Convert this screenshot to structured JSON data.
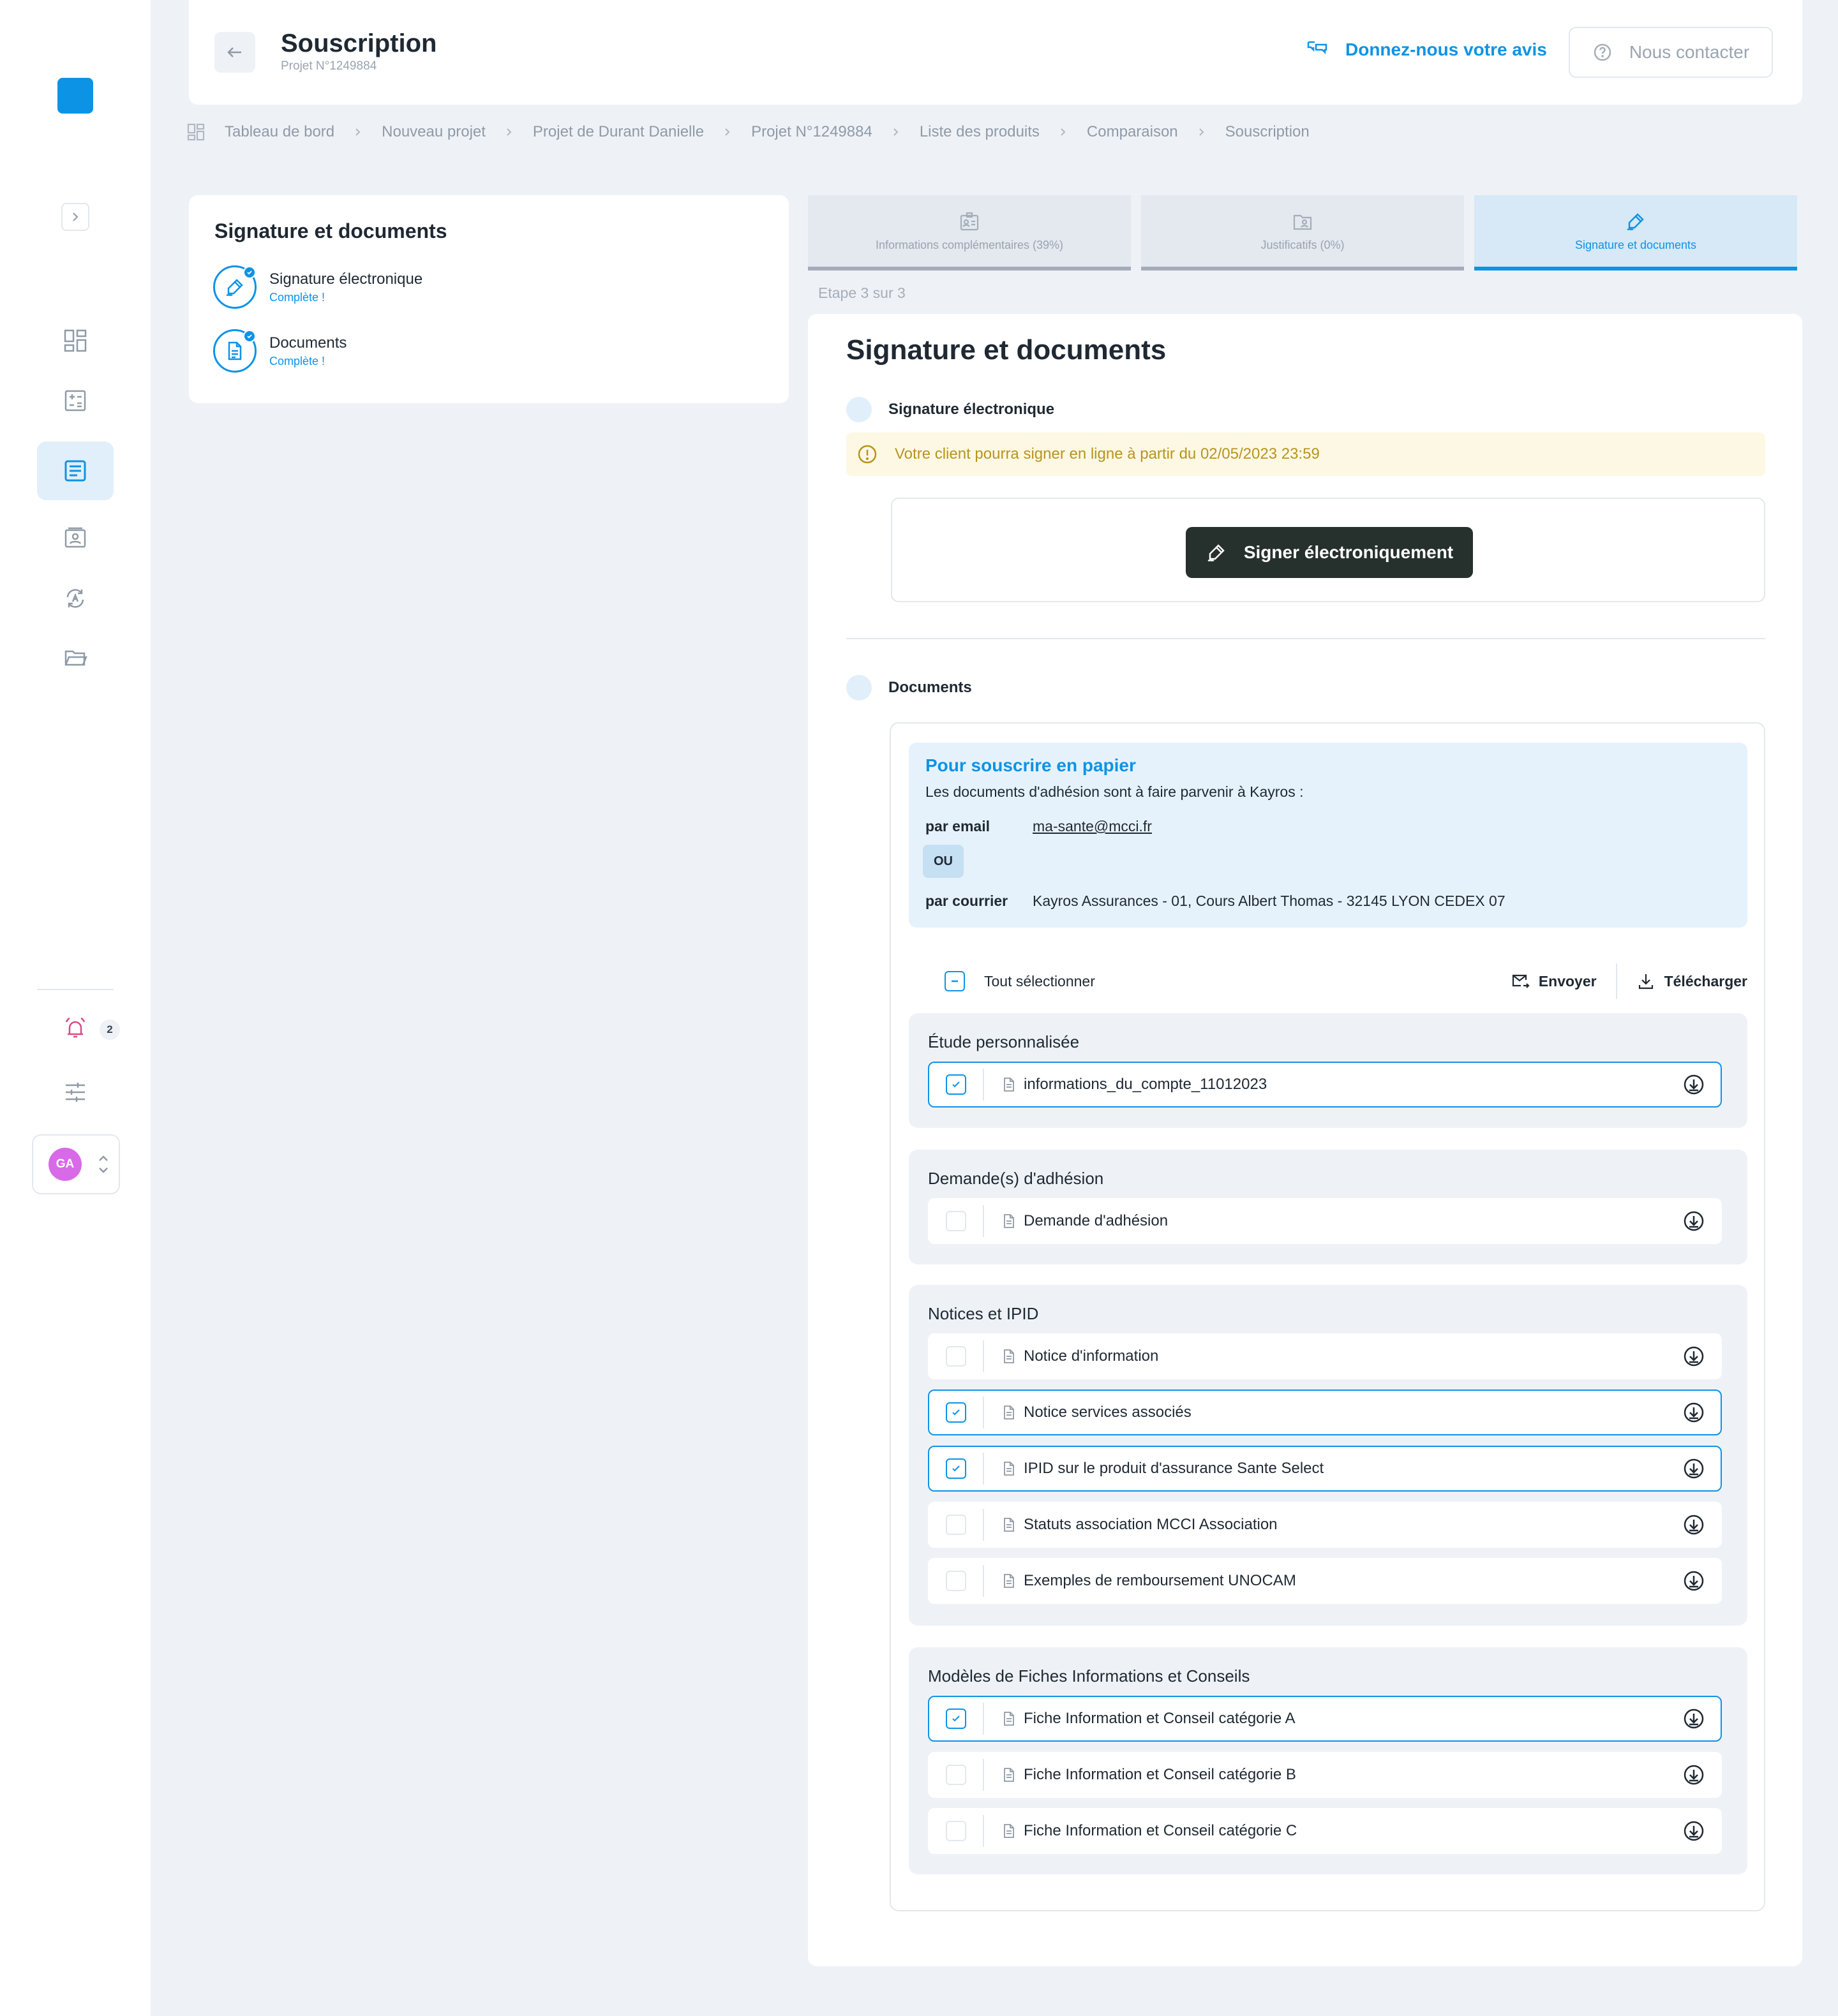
{
  "header": {
    "title": "Souscription",
    "subtitle": "Projet N°1249884",
    "feedback": "Donnez-nous votre avis",
    "contact": "Nous contacter"
  },
  "breadcrumb": [
    "Tableau de bord",
    "Nouveau projet",
    "Projet de Durant Danielle",
    "Projet N°1249884",
    "Liste des produits",
    "Comparaison",
    "Souscription"
  ],
  "sidebar": {
    "nav_icons": [
      "dashboard-icon",
      "calculator-icon",
      "document-list-icon",
      "contact-card-icon",
      "sync-icon",
      "folder-icon"
    ],
    "active_index": 2,
    "notification_count": "2",
    "avatar_initials": "GA"
  },
  "left_panel": {
    "title": "Signature et documents",
    "items": [
      {
        "label": "Signature électronique",
        "status": "Complète !"
      },
      {
        "label": "Documents",
        "status": "Complète !"
      }
    ]
  },
  "tabs": [
    {
      "label": "Informations complémentaires (39%)",
      "active": false
    },
    {
      "label": "Justificatifs (0%)",
      "active": false
    },
    {
      "label": "Signature et documents",
      "active": true
    }
  ],
  "step": "Etape 3 sur 3",
  "main": {
    "title": "Signature et documents",
    "signature_section": "Signature électronique",
    "warning": "Votre client pourra signer en ligne à partir du 02/05/2023  23:59",
    "sign_button": "Signer électroniquement",
    "documents_section": "Documents",
    "paper": {
      "title": "Pour souscrire en papier",
      "desc": "Les documents d'adhésion sont à faire parvenir à Kayros :",
      "email_label": "par email",
      "email": "ma-sante@mcci.fr",
      "or": "OU",
      "mail_label": "par courrier",
      "address": "Kayros Assurances - 01, Cours Albert Thomas - 32145 LYON CEDEX 07"
    },
    "select_all": "Tout sélectionner",
    "send": "Envoyer",
    "download": "Télécharger",
    "groups": [
      {
        "title": "Étude personnalisée",
        "docs": [
          {
            "name": "informations_du_compte_11012023",
            "checked": true
          }
        ]
      },
      {
        "title": "Demande(s) d'adhésion",
        "docs": [
          {
            "name": "Demande d'adhésion",
            "checked": false
          }
        ]
      },
      {
        "title": "Notices et IPID",
        "docs": [
          {
            "name": "Notice d'information",
            "checked": false
          },
          {
            "name": "Notice services associés",
            "checked": true
          },
          {
            "name": "IPID sur le produit d'assurance Sante Select",
            "checked": true
          },
          {
            "name": "Statuts association MCCI Association",
            "checked": false
          },
          {
            "name": "Exemples de remboursement UNOCAM",
            "checked": false
          }
        ]
      },
      {
        "title": "Modèles de Fiches Informations et Conseils",
        "docs": [
          {
            "name": "Fiche Information et Conseil catégorie A",
            "checked": true
          },
          {
            "name": "Fiche Information et Conseil catégorie B",
            "checked": false
          },
          {
            "name": "Fiche Information et Conseil catégorie C",
            "checked": false
          }
        ]
      }
    ]
  },
  "colors": {
    "accent": "#0d93e6",
    "dark_button": "#26302d",
    "warning_bg": "#fdf8e3",
    "warning_text": "#b89420"
  }
}
